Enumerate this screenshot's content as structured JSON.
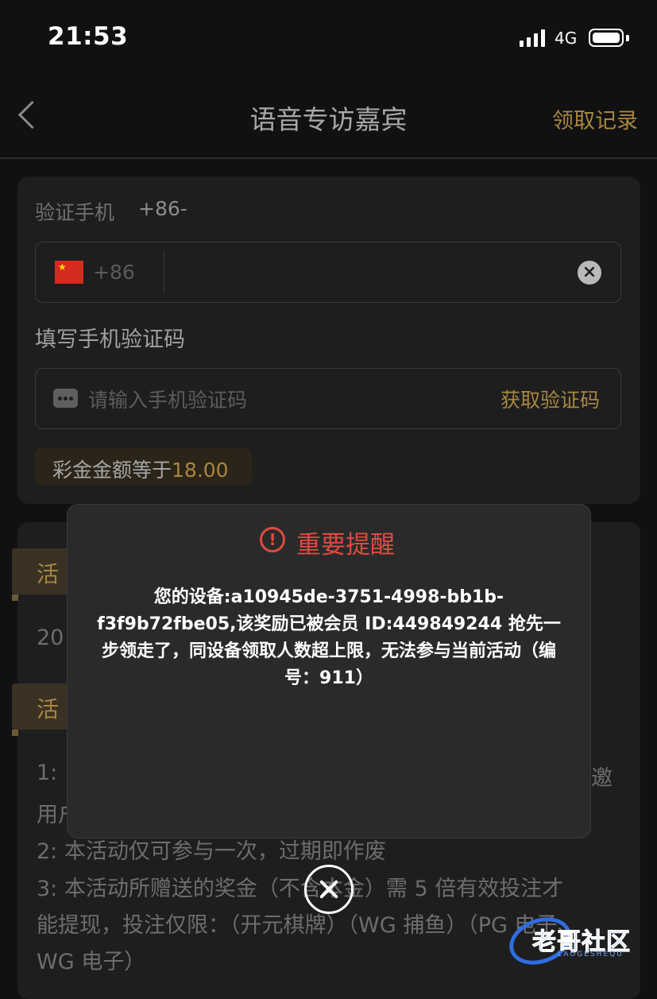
{
  "status_bar": {
    "time": "21:53",
    "network": "4G"
  },
  "nav": {
    "title": "语音专访嘉宾",
    "right_link": "领取记录"
  },
  "form": {
    "verify_phone_label": "验证手机",
    "verify_phone_value": "+86-",
    "country_code": "+86",
    "sms_label": "填写手机验证码",
    "sms_placeholder": "请输入手机验证码",
    "get_code_label": "获取验证码",
    "amount_label": "彩金金额等于",
    "amount_value": "18.00"
  },
  "background": {
    "tag1": "活",
    "year_fragment": "20",
    "tag2": "活",
    "rule1_num": "1:",
    "rule1_tail": "邀",
    "rule1_line2": "用户",
    "rule2": "2:  本活动仅可参与一次，过期即作废",
    "rule3_line1": "3:  本活动所赠送的奖金（不含本金）需 5 倍有效投注才",
    "rule3_line2": "能提现，投注仅限：（开元棋牌）（WG 捕鱼）（PG 电子、",
    "rule3_line3": "WG 电子）"
  },
  "modal": {
    "title": "重要提醒",
    "message": "您的设备:a10945de-3751-4998-bb1b-f3f9b72fbe05,该奖励已被会员 ID:449849244 抢先一步领走了，同设备领取人数超上限，无法参与当前活动（编号：911）"
  },
  "watermark": {
    "text": "老哥社区",
    "sub": "LAOGESHEQU"
  }
}
